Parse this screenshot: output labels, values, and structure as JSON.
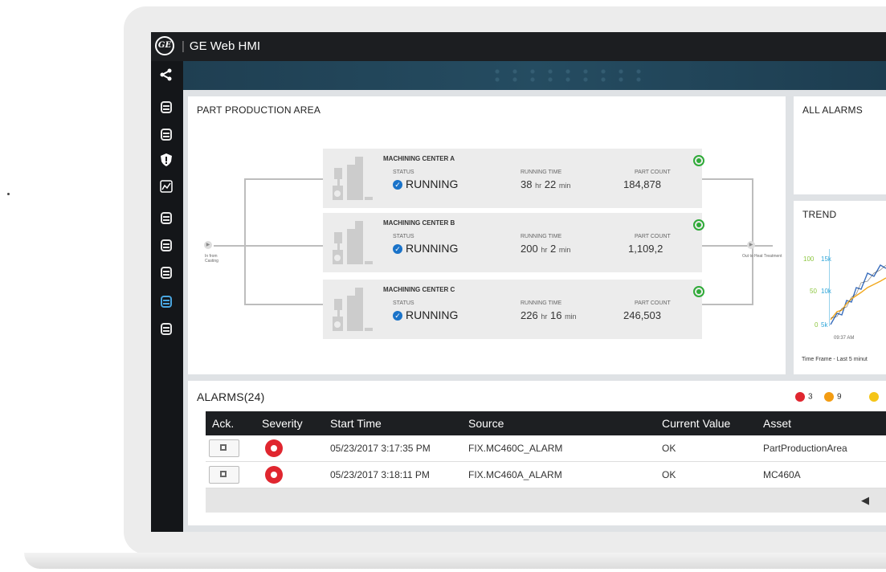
{
  "app": {
    "title": "GE Web HMI",
    "logo": "GE"
  },
  "sidebar": {
    "items": [
      {
        "icon": "share-icon"
      },
      {
        "icon": "database-icon"
      },
      {
        "icon": "database-icon"
      },
      {
        "icon": "shield-alert-icon"
      },
      {
        "icon": "trend-chart-icon"
      },
      {
        "icon": "database-icon"
      },
      {
        "icon": "database-icon"
      },
      {
        "icon": "database-icon"
      },
      {
        "icon": "database-icon",
        "active": true
      },
      {
        "icon": "database-icon"
      }
    ]
  },
  "production": {
    "title": "PART PRODUCTION AREA",
    "inflow_label": "In from Casting",
    "outflow_label": "Out to Heat Treatment",
    "status_label": "STATUS",
    "running_time_label": "RUNNING TIME",
    "part_count_label": "PART COUNT",
    "hr_unit": "hr",
    "min_unit": "min",
    "centers": [
      {
        "name": "MACHINING CENTER A",
        "status": "RUNNING",
        "hours": "38",
        "minutes": "22",
        "part_count": "184,878"
      },
      {
        "name": "MACHINING CENTER B",
        "status": "RUNNING",
        "hours": "200",
        "minutes": "2",
        "part_count": "1,109,2"
      },
      {
        "name": "MACHINING CENTER C",
        "status": "RUNNING",
        "hours": "226",
        "minutes": "16",
        "part_count": "246,503"
      }
    ]
  },
  "all_alarms": {
    "title": "ALL ALARMS"
  },
  "trend": {
    "title": "TREND",
    "time_frame": "Time Frame - Last 5 minut",
    "y_left_ticks": [
      "100",
      "50",
      "0"
    ],
    "y_right_ticks": [
      "15k",
      "10k",
      "5k"
    ],
    "x_tick": "09:37 AM",
    "colors": {
      "axis_left": "#8cc63f",
      "axis_right": "#2fa6d9",
      "series_a": "#3a6ebd",
      "series_b": "#f2a81d"
    }
  },
  "alarms": {
    "title": "ALARMS(24)",
    "counts": [
      {
        "value": "3",
        "color": "#e0262f",
        "icon": "critical-alarm-icon"
      },
      {
        "value": "9",
        "color": "#f39c12",
        "icon": "warning-alarm-icon"
      },
      {
        "value": "",
        "color": "#f5c518",
        "icon": "info-alarm-icon"
      }
    ],
    "columns": [
      "Ack.",
      "Severity",
      "Start Time",
      "Source",
      "Current Value",
      "Asset"
    ],
    "rows": [
      {
        "start_time": "05/23/2017 3:17:35 PM",
        "source": "FIX.MC460C_ALARM",
        "current_value": "OK",
        "asset": "PartProductionArea"
      },
      {
        "start_time": "05/23/2017 3:18:11 PM",
        "source": "FIX.MC460A_ALARM",
        "current_value": "OK",
        "asset": "MC460A"
      }
    ],
    "pager_prev": "◀"
  }
}
